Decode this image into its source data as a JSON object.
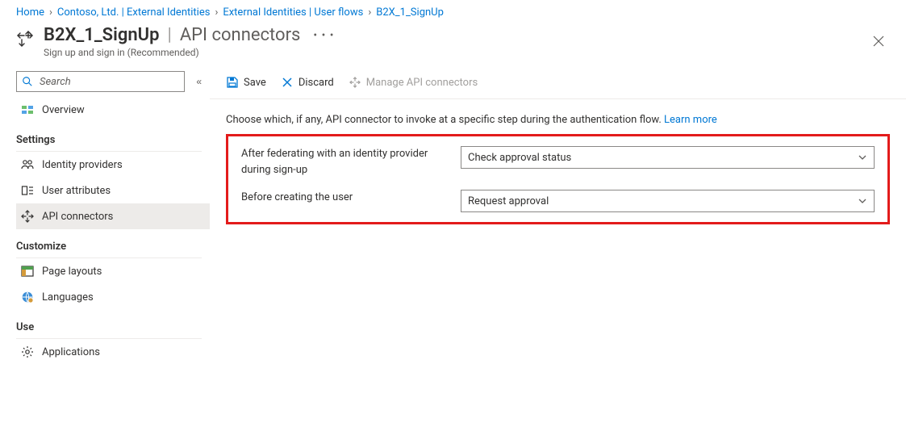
{
  "breadcrumb": {
    "items": [
      {
        "label": "Home"
      },
      {
        "label": "Contoso, Ltd. | External Identities"
      },
      {
        "label": "External Identities | User flows"
      },
      {
        "label": "B2X_1_SignUp"
      }
    ]
  },
  "header": {
    "title_main": "B2X_1_SignUp",
    "title_sub": "API connectors",
    "subtitle": "Sign up and sign in (Recommended)"
  },
  "sidebar": {
    "search_placeholder": "Search",
    "overview_label": "Overview",
    "sections": [
      {
        "title": "Settings",
        "items": [
          {
            "label": "Identity providers",
            "icon": "people-icon"
          },
          {
            "label": "User attributes",
            "icon": "attributes-icon"
          },
          {
            "label": "API connectors",
            "icon": "connectors-icon",
            "selected": true
          }
        ]
      },
      {
        "title": "Customize",
        "items": [
          {
            "label": "Page layouts",
            "icon": "layouts-icon"
          },
          {
            "label": "Languages",
            "icon": "globe-icon"
          }
        ]
      },
      {
        "title": "Use",
        "items": [
          {
            "label": "Applications",
            "icon": "gear-icon"
          }
        ]
      }
    ]
  },
  "toolbar": {
    "save_label": "Save",
    "discard_label": "Discard",
    "manage_label": "Manage API connectors"
  },
  "main": {
    "intro_text": "Choose which, if any, API connector to invoke at a specific step during the authentication flow. ",
    "learn_more": "Learn more",
    "rows": [
      {
        "label": "After federating with an identity provider during sign-up",
        "value": "Check approval status"
      },
      {
        "label": "Before creating the user",
        "value": "Request approval"
      }
    ]
  }
}
